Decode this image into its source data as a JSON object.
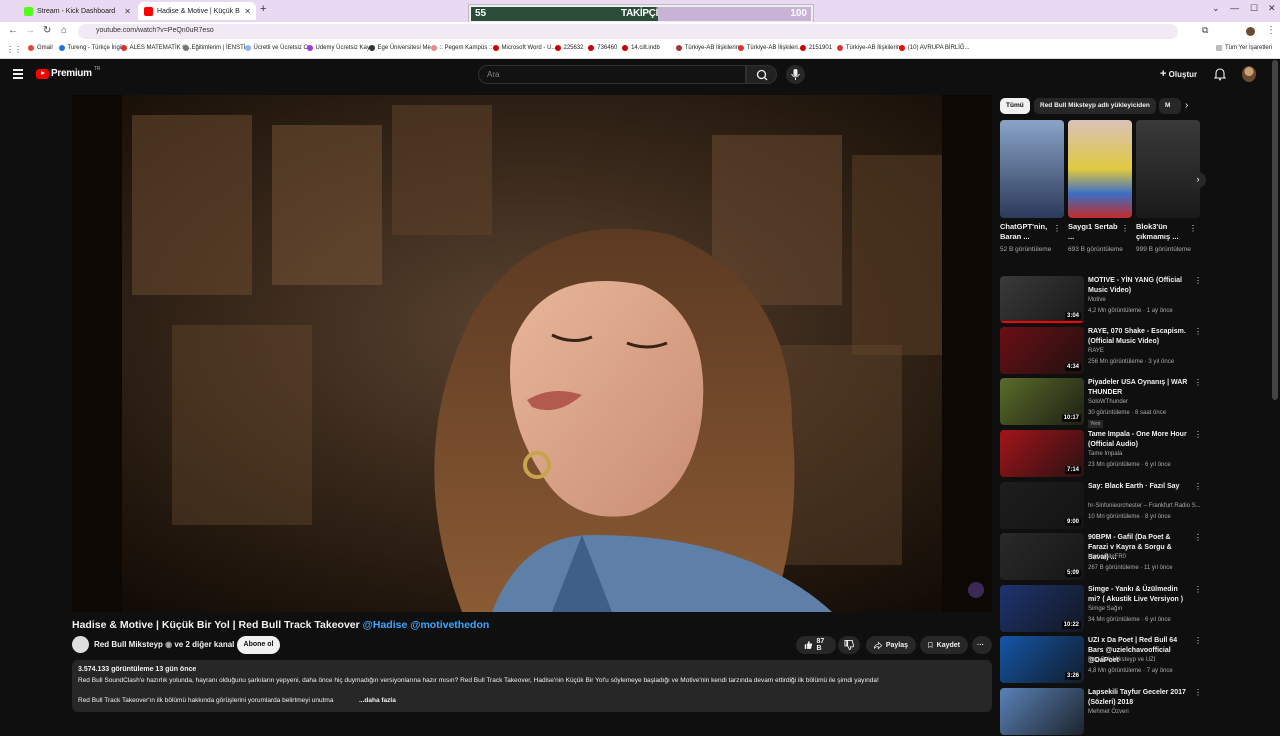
{
  "browser": {
    "tabs": [
      {
        "title": "Stream - Kick Dashboard",
        "active": false
      },
      {
        "title": "Hadise & Motive | Küçük B",
        "active": true
      }
    ],
    "url": "youtube.com/watch?v=PeQn0uR7eso",
    "bookmarks": [
      "Gmail",
      "Tureng - Türkçe İngil...",
      "ALES MATEMATİK K...",
      "Eğitimlerim | İENSTİ...",
      "Ücretli ve Ücretsiz O...",
      "Udemy Ücretsiz Kay...",
      "Ege Üniversitesi Me...",
      ":: Pegem Kampüs ::",
      "Microsoft Word - U...",
      "225632",
      "736460",
      "14.cilt.indb",
      "Türkiye-AB İlişkilerin...",
      "Türkiye-AB İlişkileri...",
      "2151901",
      "Türkiye-AB İlişkilerin...",
      "(10) AVRUPA BİRLİĞ..."
    ],
    "all_bookmarks": "Tüm Yer İşaretleri"
  },
  "kick_overlay": {
    "current": "55",
    "label": "TAKİPÇİ",
    "goal": "100",
    "progress": 0.55
  },
  "header": {
    "logo_text": "Premium",
    "country": "TR",
    "search_placeholder": "Ara",
    "create_label": "Oluştur"
  },
  "video": {
    "title": "Hadise & Motive | Küçük Bir Yol | Red Bull Track Takeover",
    "hashtags": "@Hadise @motivethedon",
    "channel": "Red Bull Mikstеyp",
    "channel_suffix": "ve 2 diğer kanal",
    "subscribe_label": "Abone ol",
    "likes": "87 B",
    "share_label": "Paylaş",
    "save_label": "Kaydet",
    "meta": "3.574.133 görüntüleme  13 gün önce",
    "description_line1": "Red Bull SoundClash'e hazırlık yolunda, hayranı olduğunu şarkıların yepyeni, daha önce hiç duymadığın versiyonlarına hazır mısın? Red Bull Track Takeover, Hadise'nin Küçük Bir Yol'u söylemeye başladığı ve Motive'nin kendi tarzında devam ettirdiği ilk bölümü ile şimdi yayında!",
    "description_line2": "Red Bull Track Takeover'ın ilk bölümü hakkında görüşlerini yorumlarda belirtmeyi unutma",
    "more_label": "...daha fazla"
  },
  "sidebar": {
    "chips": [
      "Tümü",
      "Red Bull Mikstеyp adlı yükleyiciden",
      "M"
    ],
    "shorts": [
      {
        "title": "ChatGPT'nin, Baran ...",
        "views": "52 B görüntüleme"
      },
      {
        "title": "Saygı1 Sertab ...",
        "views": "693 B görüntüleme"
      },
      {
        "title": "Blok3'ün çıkmamış ...",
        "views": "999 B görüntüleme"
      }
    ],
    "videos": [
      {
        "title": "MOTIVE - YİN YANG (Official Music Video)",
        "channel": "Motive",
        "views": "4,2 Mn görüntüleme · 1 ay önce",
        "duration": "3:04",
        "color": "#3a3a3a",
        "progress": true
      },
      {
        "title": "RAYE, 070 Shake - Escapism. (Official Music Video)",
        "channel": "RAYE",
        "views": "256 Mn görüntüleme · 3 yıl önce",
        "duration": "4:34",
        "color": "#6b0f14",
        "progress": false
      },
      {
        "title": "Piyadeler USA Oynanış | WAR THUNDER",
        "channel": "SoloWThunder",
        "views": "30 görüntüleme · 8 saat önce",
        "duration": "10:17",
        "color": "#5a6b2a",
        "badge": "Yeni",
        "progress": false
      },
      {
        "title": "Tame Impala - One More Hour (Official Audio)",
        "channel": "Tame Impala",
        "views": "23 Mn görüntüleme · 6 yıl önce",
        "duration": "7:14",
        "color": "#a3141a",
        "progress": false
      },
      {
        "title": "Say: Black Earth · Fazıl Say",
        "channel": "hr-Sinfonieorchester – Frankfurt Radio S...",
        "views": "10 Mn görüntüleme · 8 yıl önce",
        "duration": "9:00",
        "color": "#1e1e1e",
        "progress": false
      },
      {
        "title": "90BPM - Gafil (Da Poet & Farazi v Kayra & Sorgu & Savai) ...",
        "channel": "HiphopliteFR0",
        "views": "267 B görüntüleme · 11 yıl önce",
        "duration": "5:09",
        "color": "#2a2a2a",
        "progress": false
      },
      {
        "title": "Simge - Yankı & Üzülmedin mi? ( Akustik Live Versiyon )",
        "channel": "Simge Sağın",
        "views": "34 Mn görüntüleme · 6 yıl önce",
        "duration": "10:22",
        "color": "#1d3470",
        "progress": false
      },
      {
        "title": "UZI x Da Poet | Red Bull 64 Bars @uzielchavoofficial @DaPoet",
        "channel": "Red Bull Mikstеyp ve UZI",
        "views": "4,8 Mn görüntüleme · 7 ay önce",
        "duration": "3:26",
        "color": "#1456a8",
        "progress": false
      },
      {
        "title": "Lapsekili Tayfur Geceler 2017 (Sözleri) 2018",
        "channel": "Mehmet Özveri",
        "views": "",
        "duration": "",
        "color": "#5a82b8",
        "progress": false
      }
    ]
  }
}
